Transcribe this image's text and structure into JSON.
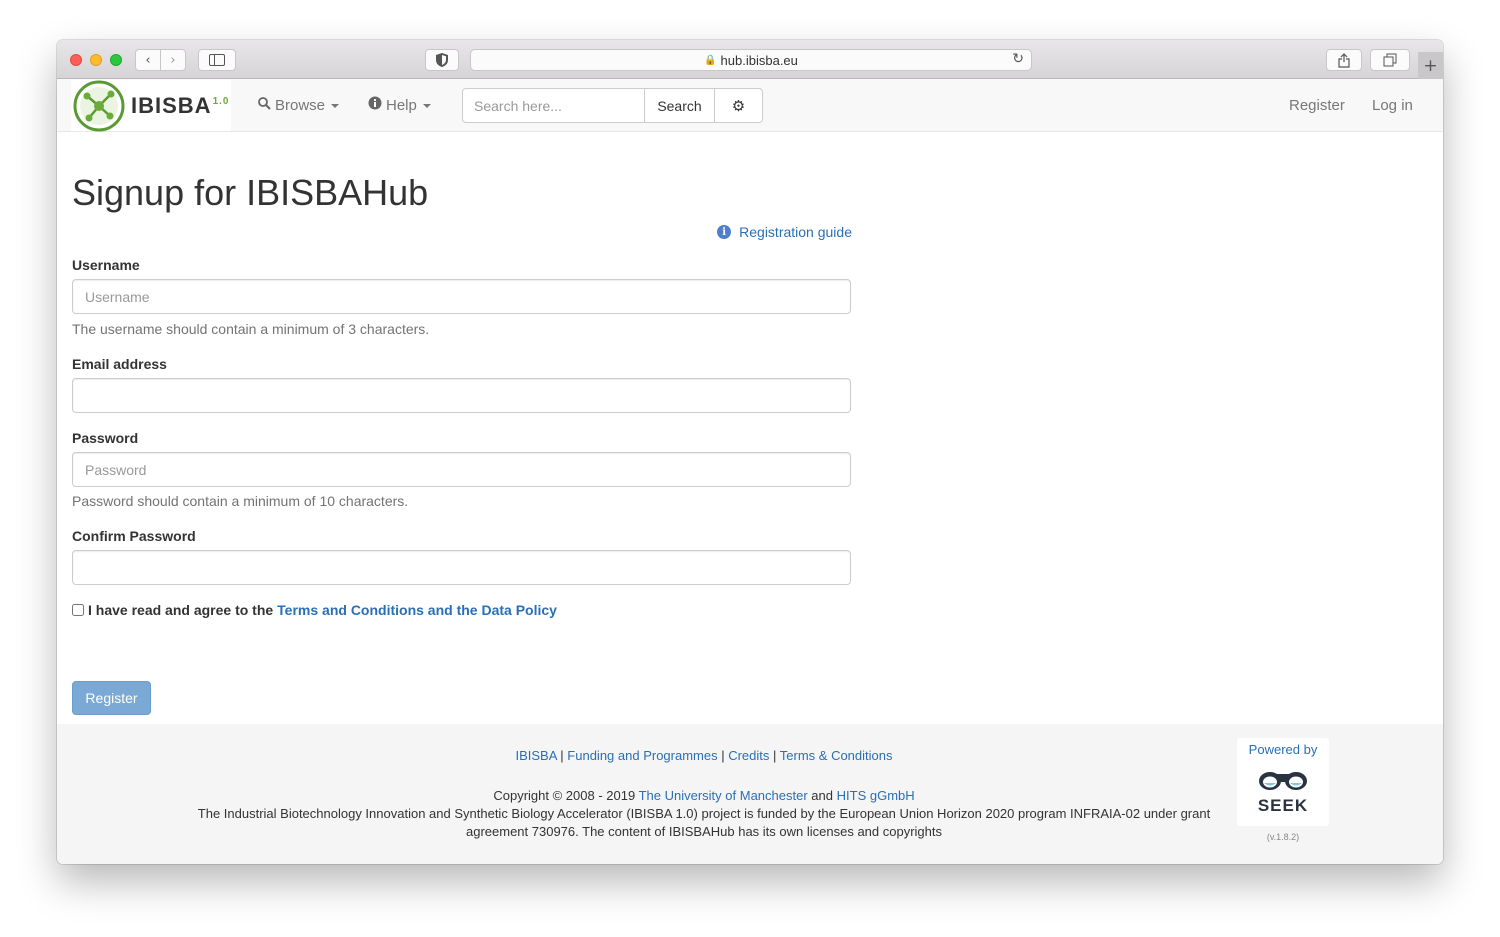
{
  "browser": {
    "url": "hub.ibisba.eu"
  },
  "navbar": {
    "brand": "IBISBA",
    "brand_version": "1.0",
    "browse_label": "Browse",
    "help_label": "Help",
    "search_placeholder": "Search here...",
    "search_button": "Search",
    "register_label": "Register",
    "login_label": "Log in"
  },
  "page": {
    "title": "Signup for IBISBAHub",
    "registration_guide": "Registration guide"
  },
  "form": {
    "username": {
      "label": "Username",
      "placeholder": "Username",
      "value": "",
      "help": "The username should contain a minimum of 3 characters."
    },
    "email": {
      "label": "Email address",
      "placeholder": "",
      "value": ""
    },
    "password": {
      "label": "Password",
      "placeholder": "Password",
      "value": "",
      "help": "Password should contain a minimum of 10 characters."
    },
    "confirm_password": {
      "label": "Confirm Password",
      "placeholder": "",
      "value": ""
    },
    "agree_text": "I have read and agree to the",
    "agree_link": "Terms and Conditions and the Data Policy",
    "agree_checked": false,
    "submit_label": "Register"
  },
  "footer": {
    "links": [
      "IBISBA",
      "Funding and Programmes",
      "Credits",
      "Terms & Conditions"
    ],
    "copyright_prefix": "Copyright © 2008 - 2019",
    "copyright_org1": "The University of Manchester",
    "copyright_and": "and",
    "copyright_org2": "HITS gGmbH",
    "funding_text": "The Industrial Biotechnology Innovation and Synthetic Biology Accelerator (IBISBA 1.0) project is funded by the European Union Horizon 2020 program INFRAIA-02 under grant agreement 730976. The content of IBISBAHub has its own licenses and copyrights",
    "powered_by": "Powered by",
    "seek_label": "SEEK",
    "seek_version": "(v.1.8.2)"
  },
  "colors": {
    "link": "#2a6fb5",
    "register_button": "#7ba9d6",
    "logo_green": "#6aab3a"
  }
}
